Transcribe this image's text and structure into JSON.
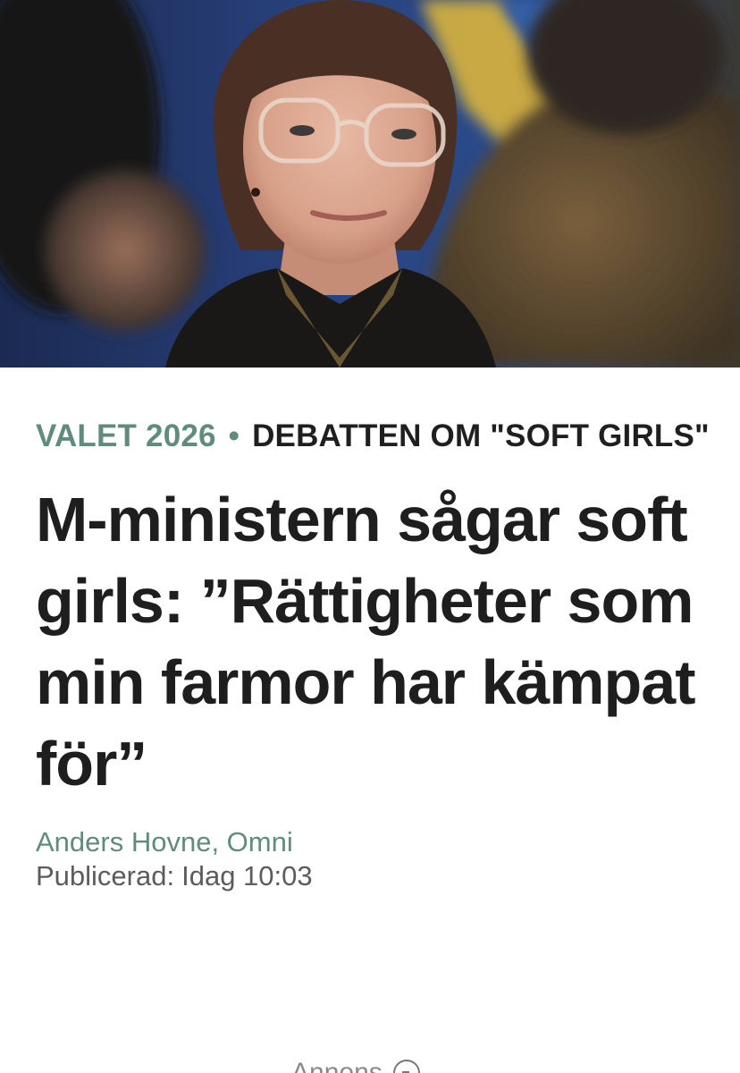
{
  "hero": {
    "image": "photo-of-minister-wearing-glasses"
  },
  "article": {
    "section": "VALET 2026",
    "separator": "•",
    "topic": "DEBATTEN OM \"SOFT GIRLS\"",
    "headline": "M-ministern sågar soft girls: ”Rättigheter som min farmor har kämpat för”",
    "author": "Anders Hovne, Omni",
    "published_label": "Publicerad:",
    "published_time": "Idag 10:03"
  },
  "ad": {
    "label": "Annons"
  },
  "colors": {
    "accent_green": "#5f8c7c",
    "headline_text": "#1e1e1e",
    "meta_text": "#5c5c5c"
  }
}
